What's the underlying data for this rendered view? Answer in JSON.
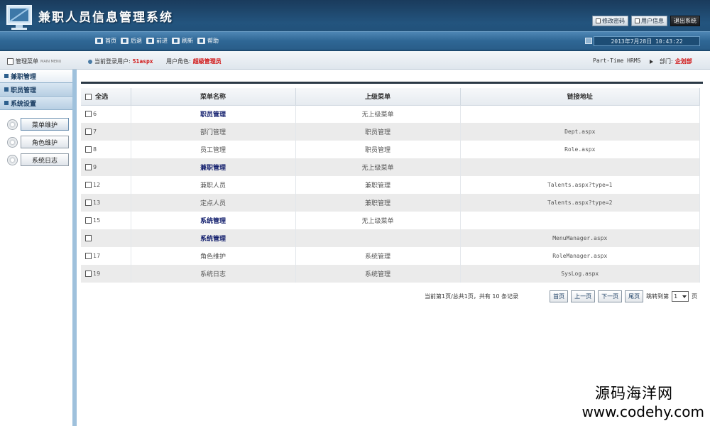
{
  "header": {
    "title": "兼职人员信息管理系统",
    "top_buttons": [
      "修改密码",
      "用户信息",
      "退出系统"
    ],
    "nav": [
      "首页",
      "后退",
      "前进",
      "刷新",
      "帮助"
    ],
    "datetime": "2013年7月28日 10:43:22"
  },
  "infobar": {
    "menu_label": "管理菜单",
    "menu_sub": "MAIN MENU",
    "current_user_label": "当前登录用户:",
    "current_user": "51aspx",
    "role_label": "用户角色:",
    "role": "超级管理员",
    "brand": "Part-Time HRMS",
    "dept_label": "部门:",
    "dept": "企划部"
  },
  "sidebar": {
    "sections": [
      "兼职管理",
      "职员管理",
      "系统设置"
    ],
    "buttons": [
      "菜单维护",
      "角色维护",
      "系统日志"
    ]
  },
  "table": {
    "headers": [
      "全选",
      "菜单名称",
      "上级菜单",
      "链接地址"
    ],
    "rows": [
      {
        "id": "6",
        "name": "职员管理",
        "parent": "无上级菜单",
        "url": "",
        "top": true
      },
      {
        "id": "7",
        "name": "部门管理",
        "parent": "职员管理",
        "url": "Dept.aspx",
        "top": false
      },
      {
        "id": "8",
        "name": "员工管理",
        "parent": "职员管理",
        "url": "Role.aspx",
        "top": false
      },
      {
        "id": "9",
        "name": "兼职管理",
        "parent": "无上级菜单",
        "url": "",
        "top": true
      },
      {
        "id": "12",
        "name": "兼职人员",
        "parent": "兼职管理",
        "url": "Talents.aspx?type=1",
        "top": false
      },
      {
        "id": "13",
        "name": "定点人员",
        "parent": "兼职管理",
        "url": "Talents.aspx?type=2",
        "top": false
      },
      {
        "id": "15",
        "name": "系统管理",
        "parent": "无上级菜单",
        "url": "",
        "top": true
      },
      {
        "id": "",
        "name": "系统管理",
        "parent": "",
        "url": "MenuManager.aspx",
        "top": true
      },
      {
        "id": "17",
        "name": "角色维护",
        "parent": "系统管理",
        "url": "RoleManager.aspx",
        "top": false
      },
      {
        "id": "19",
        "name": "系统日志",
        "parent": "系统管理",
        "url": "SysLog.aspx",
        "top": false
      }
    ]
  },
  "pager": {
    "summary": "当前第1页/总共1页，共有 10 条记录",
    "first": "首页",
    "prev": "上一页",
    "next": "下一页",
    "last": "尾页",
    "jump_label": "跳转到第",
    "page_value": "1",
    "page_suffix": "页"
  },
  "watermark": {
    "cn": "源码海洋网",
    "url": "www.codehy.com"
  },
  "colors": {
    "header_bg": "#23547e",
    "nav_bg": "#2f6795",
    "highlight_red": "#d01010",
    "parent_menu_text": "#14206e"
  }
}
